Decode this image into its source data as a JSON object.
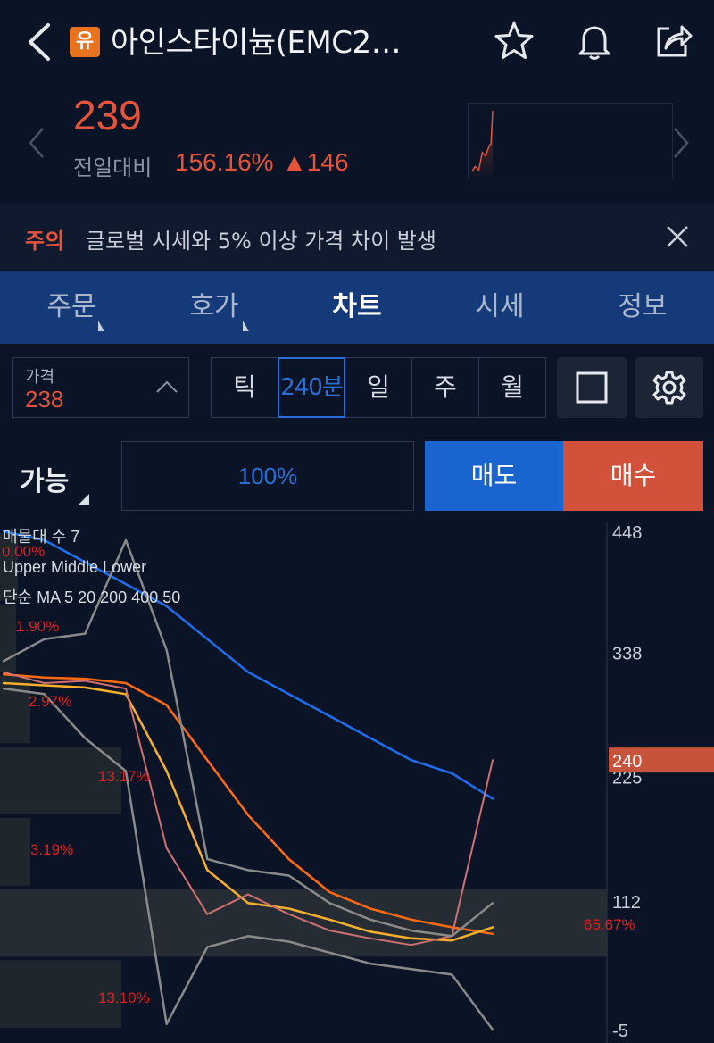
{
  "header": {
    "badge": "유",
    "title": "아인스타이늄(EMC2…"
  },
  "price": {
    "current": "239",
    "change_label": "전일대비",
    "change_pct": "156.16%",
    "change_abs": "▲146"
  },
  "warning": {
    "tag": "주의",
    "text": "글로벌 시세와 5% 이상 가격 차이 발생"
  },
  "tabs": [
    {
      "label": "주문",
      "has_menu": true
    },
    {
      "label": "호가",
      "has_menu": true
    },
    {
      "label": "차트",
      "active": true
    },
    {
      "label": "시세"
    },
    {
      "label": "정보"
    }
  ],
  "controls": {
    "price_label": "가격",
    "price_value": "238",
    "periods": [
      "틱",
      "240분",
      "일",
      "주",
      "월"
    ],
    "selected_period": "240분",
    "available_label": "가능",
    "percent": "100%",
    "sell_label": "매도",
    "buy_label": "매수"
  },
  "colors": {
    "up": "#e5543a",
    "accent": "#2a6fd8",
    "background": "#0b1426",
    "tab_bar": "#153a79"
  },
  "chart_data": {
    "type": "line",
    "legend": [
      "매물대 수 7",
      "Upper Middle Lower",
      "단순 MA 5 20 200 400 50"
    ],
    "y_ticks": [
      448,
      338,
      225,
      112,
      -5
    ],
    "ylim": [
      -5,
      448
    ],
    "current_price_tag": "240",
    "volume_profile_pcts": [
      "0.00%",
      "1.90%",
      "2.97%",
      "13.17%",
      "3.19%",
      "65.67%",
      "13.10%"
    ],
    "series": [
      {
        "name": "200",
        "color": "#1e6ff0",
        "values": [
          448,
          440,
          420,
          400,
          380,
          350,
          320,
          300,
          280,
          260,
          240,
          228,
          205
        ]
      },
      {
        "name": "50",
        "color": "#ff6a10",
        "values": [
          318,
          315,
          314,
          310,
          290,
          240,
          190,
          150,
          120,
          105,
          95,
          88,
          82
        ]
      },
      {
        "name": "20",
        "color": "#f6b02c",
        "values": [
          310,
          308,
          306,
          300,
          230,
          140,
          110,
          105,
          95,
          84,
          78,
          76,
          88
        ]
      },
      {
        "name": "5",
        "color": "#d07070",
        "values": [
          320,
          310,
          312,
          305,
          160,
          100,
          118,
          100,
          85,
          78,
          72,
          80,
          240
        ]
      },
      {
        "name": "Upper",
        "color": "#8a8a8a",
        "values": [
          330,
          350,
          355,
          440,
          340,
          150,
          140,
          135,
          110,
          95,
          85,
          80,
          110
        ]
      },
      {
        "name": "Lower",
        "color": "#8a8a8a",
        "values": [
          305,
          300,
          260,
          230,
          0,
          70,
          80,
          75,
          65,
          55,
          50,
          45,
          -5
        ]
      }
    ]
  }
}
